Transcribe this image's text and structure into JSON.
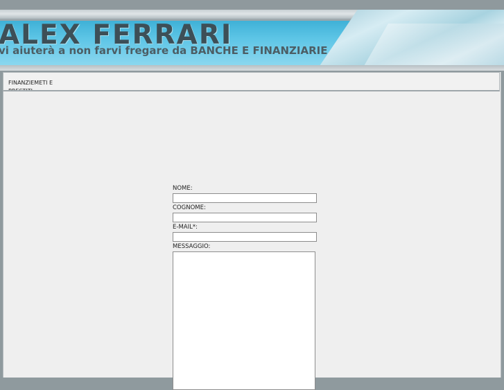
{
  "header": {
    "title": "ALEX FERRARI",
    "subtitle": "vi aiuterà a non farvi fregare da BANCHE E FINANZIARIE"
  },
  "nav": {
    "link_label": "FINANZIEMETI E PRESTITI"
  },
  "form": {
    "nome_label": "NOME:",
    "cognome_label": "COGNOME:",
    "email_label": "E-MAIL*:",
    "messaggio_label": "MESSAGGIO:",
    "nome_value": "",
    "cognome_value": "",
    "email_value": "",
    "messaggio_value": ""
  }
}
